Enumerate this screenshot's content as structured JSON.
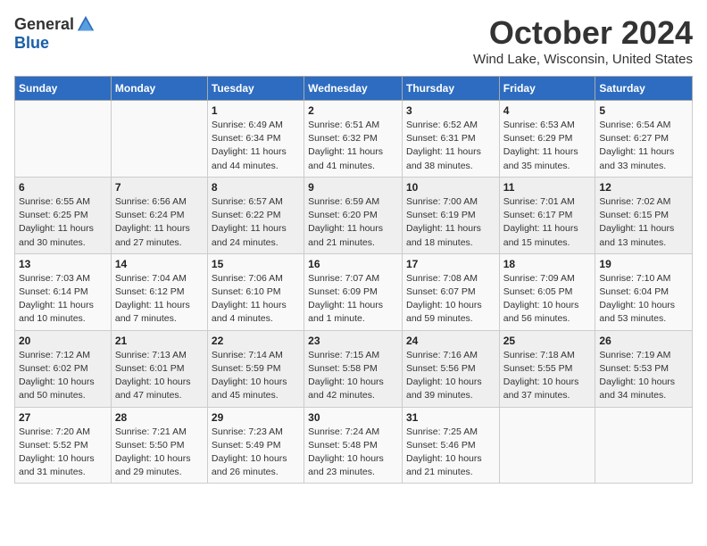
{
  "header": {
    "logo_general": "General",
    "logo_blue": "Blue",
    "month": "October 2024",
    "location": "Wind Lake, Wisconsin, United States"
  },
  "days_of_week": [
    "Sunday",
    "Monday",
    "Tuesday",
    "Wednesday",
    "Thursday",
    "Friday",
    "Saturday"
  ],
  "weeks": [
    [
      {
        "day": "",
        "detail": ""
      },
      {
        "day": "",
        "detail": ""
      },
      {
        "day": "1",
        "detail": "Sunrise: 6:49 AM\nSunset: 6:34 PM\nDaylight: 11 hours and 44 minutes."
      },
      {
        "day": "2",
        "detail": "Sunrise: 6:51 AM\nSunset: 6:32 PM\nDaylight: 11 hours and 41 minutes."
      },
      {
        "day": "3",
        "detail": "Sunrise: 6:52 AM\nSunset: 6:31 PM\nDaylight: 11 hours and 38 minutes."
      },
      {
        "day": "4",
        "detail": "Sunrise: 6:53 AM\nSunset: 6:29 PM\nDaylight: 11 hours and 35 minutes."
      },
      {
        "day": "5",
        "detail": "Sunrise: 6:54 AM\nSunset: 6:27 PM\nDaylight: 11 hours and 33 minutes."
      }
    ],
    [
      {
        "day": "6",
        "detail": "Sunrise: 6:55 AM\nSunset: 6:25 PM\nDaylight: 11 hours and 30 minutes."
      },
      {
        "day": "7",
        "detail": "Sunrise: 6:56 AM\nSunset: 6:24 PM\nDaylight: 11 hours and 27 minutes."
      },
      {
        "day": "8",
        "detail": "Sunrise: 6:57 AM\nSunset: 6:22 PM\nDaylight: 11 hours and 24 minutes."
      },
      {
        "day": "9",
        "detail": "Sunrise: 6:59 AM\nSunset: 6:20 PM\nDaylight: 11 hours and 21 minutes."
      },
      {
        "day": "10",
        "detail": "Sunrise: 7:00 AM\nSunset: 6:19 PM\nDaylight: 11 hours and 18 minutes."
      },
      {
        "day": "11",
        "detail": "Sunrise: 7:01 AM\nSunset: 6:17 PM\nDaylight: 11 hours and 15 minutes."
      },
      {
        "day": "12",
        "detail": "Sunrise: 7:02 AM\nSunset: 6:15 PM\nDaylight: 11 hours and 13 minutes."
      }
    ],
    [
      {
        "day": "13",
        "detail": "Sunrise: 7:03 AM\nSunset: 6:14 PM\nDaylight: 11 hours and 10 minutes."
      },
      {
        "day": "14",
        "detail": "Sunrise: 7:04 AM\nSunset: 6:12 PM\nDaylight: 11 hours and 7 minutes."
      },
      {
        "day": "15",
        "detail": "Sunrise: 7:06 AM\nSunset: 6:10 PM\nDaylight: 11 hours and 4 minutes."
      },
      {
        "day": "16",
        "detail": "Sunrise: 7:07 AM\nSunset: 6:09 PM\nDaylight: 11 hours and 1 minute."
      },
      {
        "day": "17",
        "detail": "Sunrise: 7:08 AM\nSunset: 6:07 PM\nDaylight: 10 hours and 59 minutes."
      },
      {
        "day": "18",
        "detail": "Sunrise: 7:09 AM\nSunset: 6:05 PM\nDaylight: 10 hours and 56 minutes."
      },
      {
        "day": "19",
        "detail": "Sunrise: 7:10 AM\nSunset: 6:04 PM\nDaylight: 10 hours and 53 minutes."
      }
    ],
    [
      {
        "day": "20",
        "detail": "Sunrise: 7:12 AM\nSunset: 6:02 PM\nDaylight: 10 hours and 50 minutes."
      },
      {
        "day": "21",
        "detail": "Sunrise: 7:13 AM\nSunset: 6:01 PM\nDaylight: 10 hours and 47 minutes."
      },
      {
        "day": "22",
        "detail": "Sunrise: 7:14 AM\nSunset: 5:59 PM\nDaylight: 10 hours and 45 minutes."
      },
      {
        "day": "23",
        "detail": "Sunrise: 7:15 AM\nSunset: 5:58 PM\nDaylight: 10 hours and 42 minutes."
      },
      {
        "day": "24",
        "detail": "Sunrise: 7:16 AM\nSunset: 5:56 PM\nDaylight: 10 hours and 39 minutes."
      },
      {
        "day": "25",
        "detail": "Sunrise: 7:18 AM\nSunset: 5:55 PM\nDaylight: 10 hours and 37 minutes."
      },
      {
        "day": "26",
        "detail": "Sunrise: 7:19 AM\nSunset: 5:53 PM\nDaylight: 10 hours and 34 minutes."
      }
    ],
    [
      {
        "day": "27",
        "detail": "Sunrise: 7:20 AM\nSunset: 5:52 PM\nDaylight: 10 hours and 31 minutes."
      },
      {
        "day": "28",
        "detail": "Sunrise: 7:21 AM\nSunset: 5:50 PM\nDaylight: 10 hours and 29 minutes."
      },
      {
        "day": "29",
        "detail": "Sunrise: 7:23 AM\nSunset: 5:49 PM\nDaylight: 10 hours and 26 minutes."
      },
      {
        "day": "30",
        "detail": "Sunrise: 7:24 AM\nSunset: 5:48 PM\nDaylight: 10 hours and 23 minutes."
      },
      {
        "day": "31",
        "detail": "Sunrise: 7:25 AM\nSunset: 5:46 PM\nDaylight: 10 hours and 21 minutes."
      },
      {
        "day": "",
        "detail": ""
      },
      {
        "day": "",
        "detail": ""
      }
    ]
  ]
}
